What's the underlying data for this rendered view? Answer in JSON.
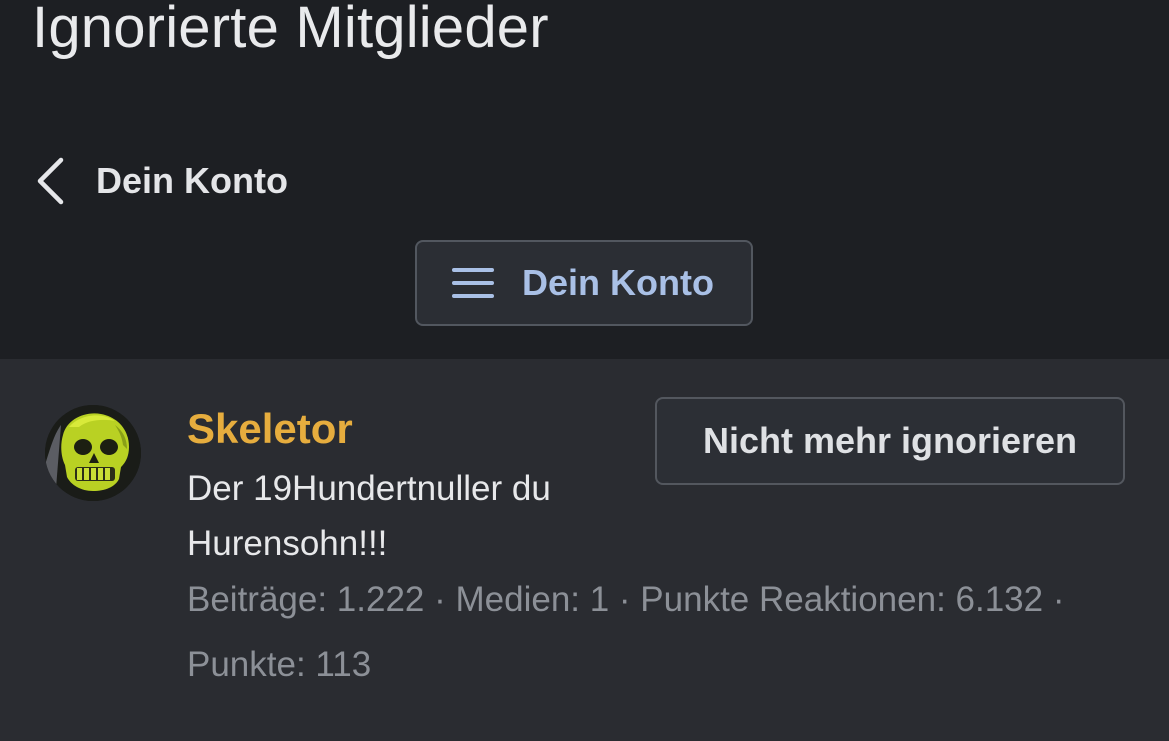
{
  "page": {
    "title": "Ignorierte Mitglieder"
  },
  "nav": {
    "back_label": "Dein Konto",
    "back_icon": "chevron-left-icon",
    "menu_label": "Dein Konto",
    "menu_icon": "hamburger-menu-icon"
  },
  "member": {
    "name": "Skeletor",
    "title": "Der 19Hundertnuller du Hurensohn!!!",
    "stats": "Beiträge: 1.222 · Medien: 1 · Punkte Reaktionen: 6.132 · Punkte: 113",
    "avatar_icon": "skeleton-face-avatar",
    "unignore_label": "Nicht mehr ignorieren"
  },
  "colors": {
    "background_header": "#1d1f23",
    "background_content": "#2a2c31",
    "username": "#e6ad3e",
    "menu_accent": "#a9c0e6",
    "muted_text": "#8c9097"
  }
}
